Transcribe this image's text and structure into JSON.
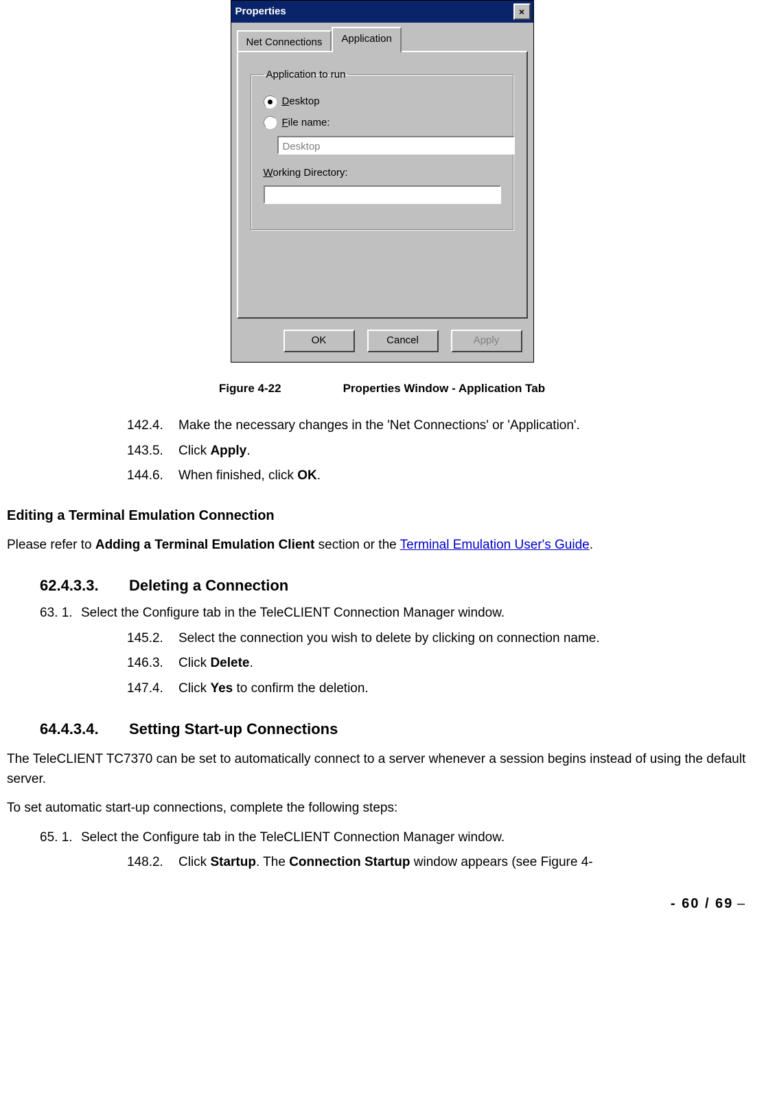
{
  "dialog": {
    "title": "Properties",
    "close_glyph": "×",
    "tabs": {
      "net": "Net Connections",
      "app": "Application"
    },
    "group_legend": "Application to run",
    "radio_desktop": {
      "u": "D",
      "rest": "esktop"
    },
    "radio_filename": {
      "u": "F",
      "rest": "ile name:"
    },
    "filename_value": "Desktop",
    "workdir_label": {
      "u": "W",
      "rest": "orking Directory:"
    },
    "workdir_value": "",
    "buttons": {
      "ok": "OK",
      "cancel": "Cancel",
      "apply": "Apply"
    }
  },
  "figure": {
    "num": "Figure 4-22",
    "title": "Properties Window - Application Tab"
  },
  "steps_a": [
    {
      "n": "142.4.",
      "t_before": "Make the necessary changes in the 'Net Connections' or 'Application'."
    },
    {
      "n": "143.5.",
      "t_before": "Click ",
      "bold": "Apply",
      "t_after": "."
    },
    {
      "n": "144.6.",
      "t_before": "When finished, click ",
      "bold": "OK",
      "t_after": "."
    }
  ],
  "edit_term_heading": "Editing a Terminal Emulation Connection",
  "edit_term_para": {
    "a": "Please refer to ",
    "b": "Adding a Terminal Emulation Client",
    "c": " section or the ",
    "link": "Terminal Emulation User's Guide",
    "d": "."
  },
  "sec1": {
    "num": "62.4.3.3.",
    "title": "Deleting a Connection"
  },
  "sec1_first": {
    "n": "63. 1.",
    "t": "Select the Configure tab in the TeleCLIENT Connection Manager window."
  },
  "steps_b": [
    {
      "n": "145.2.",
      "t_before": "Select the connection you wish to delete by clicking on connection name."
    },
    {
      "n": "146.3.",
      "t_before": "Click ",
      "bold": "Delete",
      "t_after": "."
    },
    {
      "n": "147.4.",
      "t_before": "Click ",
      "bold": "Yes",
      "t_after": " to confirm the deletion."
    }
  ],
  "sec2": {
    "num": "64.4.3.4.",
    "title": "Setting Start-up Connections"
  },
  "sec2_para1": "The TeleCLIENT TC7370 can be set to automatically connect to a server whenever a session begins instead of using the default server.",
  "sec2_para2": "To set automatic start-up connections, complete the following steps:",
  "sec2_first": {
    "n": "65. 1.",
    "t": "Select the Configure tab in the TeleCLIENT Connection Manager window."
  },
  "steps_c": [
    {
      "n": "148.2.",
      "a": "Click ",
      "b": "Startup",
      "c": ".   The ",
      "d": "Connection Startup",
      "e": " window appears (see Figure 4-"
    }
  ],
  "page_number": {
    "a": "- ",
    "b": "60 / 69",
    "c": " –"
  }
}
